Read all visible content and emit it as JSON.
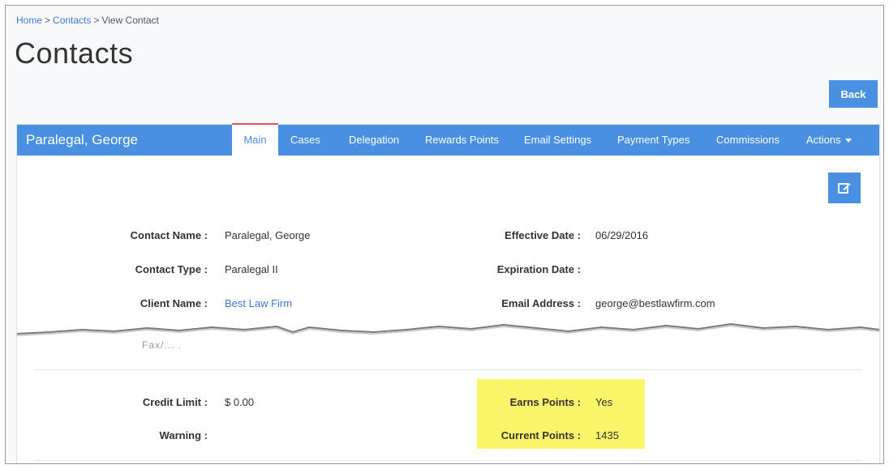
{
  "breadcrumb": {
    "home": "Home",
    "sep1": ">",
    "contacts": "Contacts",
    "sep2": ">",
    "current": "View Contact"
  },
  "page_title": "Contacts",
  "back_button": "Back",
  "contact_header": {
    "name": "Paralegal, George"
  },
  "tabs": [
    {
      "label": "Main",
      "active": true
    },
    {
      "label": "Cases"
    },
    {
      "label": "Delegation"
    },
    {
      "label": "Rewards Points"
    },
    {
      "label": "Email Settings"
    },
    {
      "label": "Payment Types"
    },
    {
      "label": "Commissions"
    },
    {
      "label": "Actions"
    }
  ],
  "icons": {
    "edit": "edit-icon",
    "actions_caret": "caret-down-icon"
  },
  "colors": {
    "accent": "#4a90e2",
    "active_tab_border": "#e9505a",
    "highlight": "#fbf569",
    "link": "#3a7bd5"
  },
  "fields_left": [
    {
      "label": "Contact Name :",
      "value": "Paralegal, George"
    },
    {
      "label": "Contact Type :",
      "value": "Paralegal II"
    },
    {
      "label": "Client Name :",
      "value": "Best Law Firm"
    }
  ],
  "fields_right": [
    {
      "label": "Effective Date :",
      "value": "06/29/2016"
    },
    {
      "label": "Expiration Date :",
      "value": ""
    },
    {
      "label": "Email Address :",
      "value": "george@bestlawfirm.com"
    }
  ],
  "partial_text": "Fax/...  .",
  "credit": {
    "credit_limit_label": "Credit Limit :",
    "credit_limit_value": "$ 0.00",
    "warning_label": "Warning :",
    "warning_value": ""
  },
  "points": {
    "earns_points_label": "Earns Points :",
    "earns_points_value": "Yes",
    "current_points_label": "Current Points :",
    "current_points_value": "1435"
  }
}
